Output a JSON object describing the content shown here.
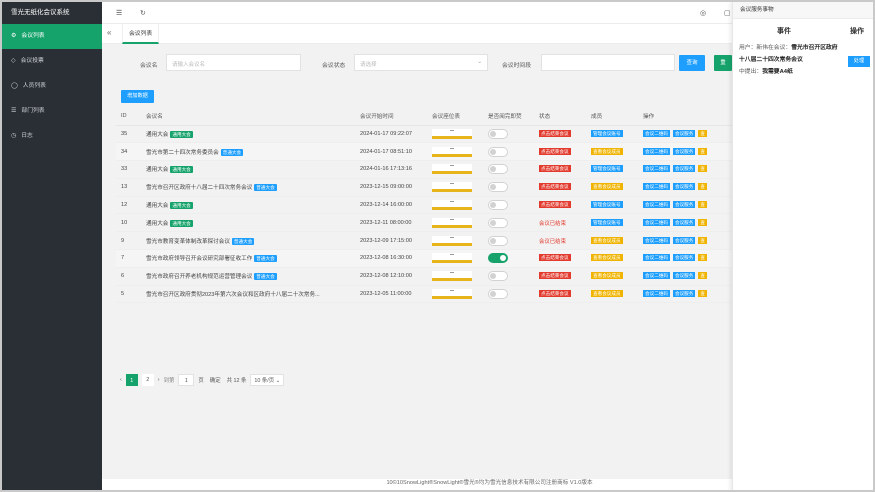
{
  "app_title": "雪光无纸化会议系统",
  "sidebar": {
    "items": [
      {
        "label": "会议列表",
        "active": true,
        "icon": "settings-icon"
      },
      {
        "label": "会议投票",
        "active": false,
        "icon": "tag-icon"
      },
      {
        "label": "人员列表",
        "active": false,
        "icon": "user-icon"
      },
      {
        "label": "部门列表",
        "active": false,
        "icon": "list-icon"
      },
      {
        "label": "日志",
        "active": false,
        "icon": "clock-icon"
      }
    ]
  },
  "tab": {
    "label": "会议列表"
  },
  "filters": {
    "name_label": "会议名",
    "name_placeholder": "请输入会议名",
    "status_label": "会议状态",
    "status_placeholder": "请选择",
    "time_label": "会议时间段",
    "query_label": "查询",
    "reset_label": "重"
  },
  "add_button": "增加数据",
  "table": {
    "headers": [
      "ID",
      "会议名",
      "会议开始时间",
      "会议座位表",
      "是否阅完即焚",
      "状态",
      "成员",
      "操作"
    ],
    "rows": [
      {
        "id": "35",
        "name": "通用大会",
        "tag": "通用大会",
        "tag_type": "green",
        "time": "2024-01-17 09:22:07",
        "burn": false,
        "status": "点击结束会议",
        "status_type": "btn",
        "member": "管理会议账号",
        "member_type": "blue",
        "ops": [
          "会议二维码",
          "会议服务",
          "查"
        ],
        "shade": false
      },
      {
        "id": "34",
        "name": "雪光市第二十四次常务委员会",
        "tag": "普通大会",
        "tag_type": "blue",
        "time": "2024-01-17 08:51:10",
        "burn": false,
        "status": "点击结束会议",
        "status_type": "btn",
        "member": "查看会议成员",
        "member_type": "yellow",
        "ops": [
          "会议二维码",
          "会议服务",
          "查"
        ],
        "shade": true
      },
      {
        "id": "33",
        "name": "通用大会",
        "tag": "通用大会",
        "tag_type": "green",
        "time": "2024-01-16 17:13:16",
        "burn": false,
        "status": "点击结束会议",
        "status_type": "btn",
        "member": "管理会议账号",
        "member_type": "blue",
        "ops": [
          "会议二维码",
          "会议服务",
          "查"
        ],
        "shade": false
      },
      {
        "id": "13",
        "name": "雪光市召开区政府十八届二十四次常务会议",
        "tag": "普通大会",
        "tag_type": "blue",
        "time": "2023-12-15 09:00:00",
        "burn": false,
        "status": "点击结束会议",
        "status_type": "btn",
        "member": "查看会议成员",
        "member_type": "yellow",
        "ops": [
          "会议二维码",
          "会议服务",
          "查"
        ],
        "shade": false
      },
      {
        "id": "12",
        "name": "通用大会",
        "tag": "通用大会",
        "tag_type": "green",
        "time": "2023-12-14 16:00:00",
        "burn": false,
        "status": "点击结束会议",
        "status_type": "btn",
        "member": "管理会议账号",
        "member_type": "blue",
        "ops": [
          "会议二维码",
          "会议服务",
          "查"
        ],
        "shade": false
      },
      {
        "id": "10",
        "name": "通用大会",
        "tag": "通用大会",
        "tag_type": "green",
        "time": "2023-12-11 08:00:00",
        "burn": false,
        "status": "会议已结束",
        "status_type": "text",
        "member": "管理会议账号",
        "member_type": "blue",
        "ops": [
          "会议二维码",
          "会议服务",
          "查"
        ],
        "shade": false
      },
      {
        "id": "9",
        "name": "雪光市教育变革体制改革探讨会议",
        "tag": "普通大会",
        "tag_type": "blue",
        "time": "2023-12-09 17:15:00",
        "burn": false,
        "status": "会议已结束",
        "status_type": "text",
        "member": "查看会议成员",
        "member_type": "yellow",
        "ops": [
          "会议二维码",
          "会议服务",
          "查"
        ],
        "shade": false
      },
      {
        "id": "7",
        "name": "雪光市政府领导召开会议研究部署征收工作",
        "tag": "普通大会",
        "tag_type": "blue",
        "time": "2023-12-08 16:30:00",
        "burn": true,
        "status": "点击结束会议",
        "status_type": "btn",
        "member": "查看会议成员",
        "member_type": "yellow",
        "ops": [
          "会议二维码",
          "会议服务",
          "查"
        ],
        "shade": true
      },
      {
        "id": "6",
        "name": "雪光市政府召开养老机构规范运营管理会议",
        "tag": "普通大会",
        "tag_type": "blue",
        "time": "2023-12-08 12:10:00",
        "burn": false,
        "status": "点击结束会议",
        "status_type": "btn",
        "member": "查看会议成员",
        "member_type": "yellow",
        "ops": [
          "会议二维码",
          "会议服务",
          "查"
        ],
        "shade": false
      },
      {
        "id": "5",
        "name": "雪光市召开区政府贯彻2023年第六次会议和区政府十八届二十次常务...",
        "tag": "",
        "tag_type": "",
        "time": "2023-12-05 11:00:00",
        "burn": false,
        "status": "点击结束会议",
        "status_type": "btn",
        "member": "查看会议成员",
        "member_type": "yellow",
        "ops": [
          "会议二维码",
          "会议服务",
          "查"
        ],
        "shade": false
      }
    ]
  },
  "pager": {
    "pages": [
      "1",
      "2"
    ],
    "goto_label": "到第",
    "goto_value": "1",
    "page_unit": "页",
    "confirm": "确定",
    "total": "共 12 条",
    "page_size": "10 条/页"
  },
  "footer": "10©10SnowLight®SnowLight®雪光®均为雪光信息技术有限公司注册商标 V1.0版本",
  "right_panel": {
    "title": "会议服务事物",
    "col_event": "事件",
    "col_action": "操作",
    "line1_label": "用户：",
    "line1_value": "新伟在会议：",
    "line2_value": "雪光市召开区政府十八届二十四次常务会议",
    "line3_label": "中提出：",
    "line3_value": "我需要A4纸",
    "handle": "处理"
  }
}
